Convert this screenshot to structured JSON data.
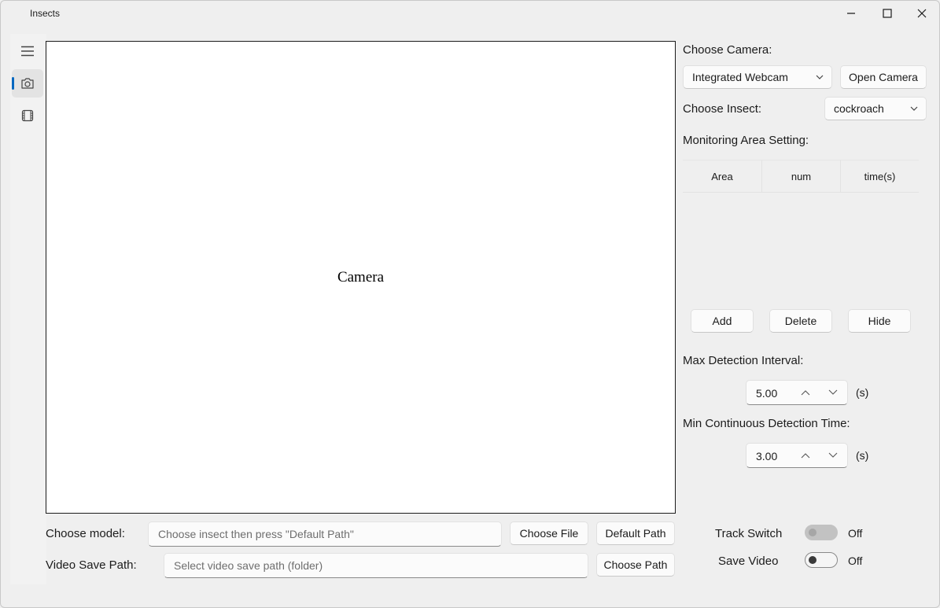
{
  "window": {
    "title": "Insects"
  },
  "nav": {
    "items": [
      {
        "icon": "menu-icon"
      },
      {
        "icon": "camera-icon",
        "active": true
      },
      {
        "icon": "film-icon"
      }
    ]
  },
  "camera_view": {
    "label": "Camera"
  },
  "right_panel": {
    "choose_camera_label": "Choose Camera:",
    "camera_select": "Integrated Webcam",
    "open_camera_button": "Open Camera",
    "choose_insect_label": "Choose Insect:",
    "insect_select": "cockroach",
    "monitoring_label": "Monitoring Area Setting:",
    "table_headers": [
      "Area",
      "num",
      "time(s)"
    ],
    "add_button": "Add",
    "delete_button": "Delete",
    "hide_button": "Hide",
    "max_interval_label": "Max Detection Interval:",
    "max_interval_value": "5.00",
    "min_continuous_label": "Min Continuous Detection Time:",
    "min_continuous_value": "3.00",
    "unit": "(s)"
  },
  "bottom": {
    "choose_model_label": "Choose model:",
    "model_placeholder": "Choose insect then press \"Default Path\"",
    "choose_file_button": "Choose File",
    "default_path_button": "Default Path",
    "video_save_label": "Video Save Path:",
    "video_save_placeholder": "Select video save path (folder)",
    "choose_path_button": "Choose Path",
    "track_switch_label": "Track Switch",
    "track_switch_state": "Off",
    "save_video_label": "Save Video",
    "save_video_state": "Off"
  },
  "colors": {
    "accent": "#0067c0",
    "background": "#f0f0f0"
  }
}
